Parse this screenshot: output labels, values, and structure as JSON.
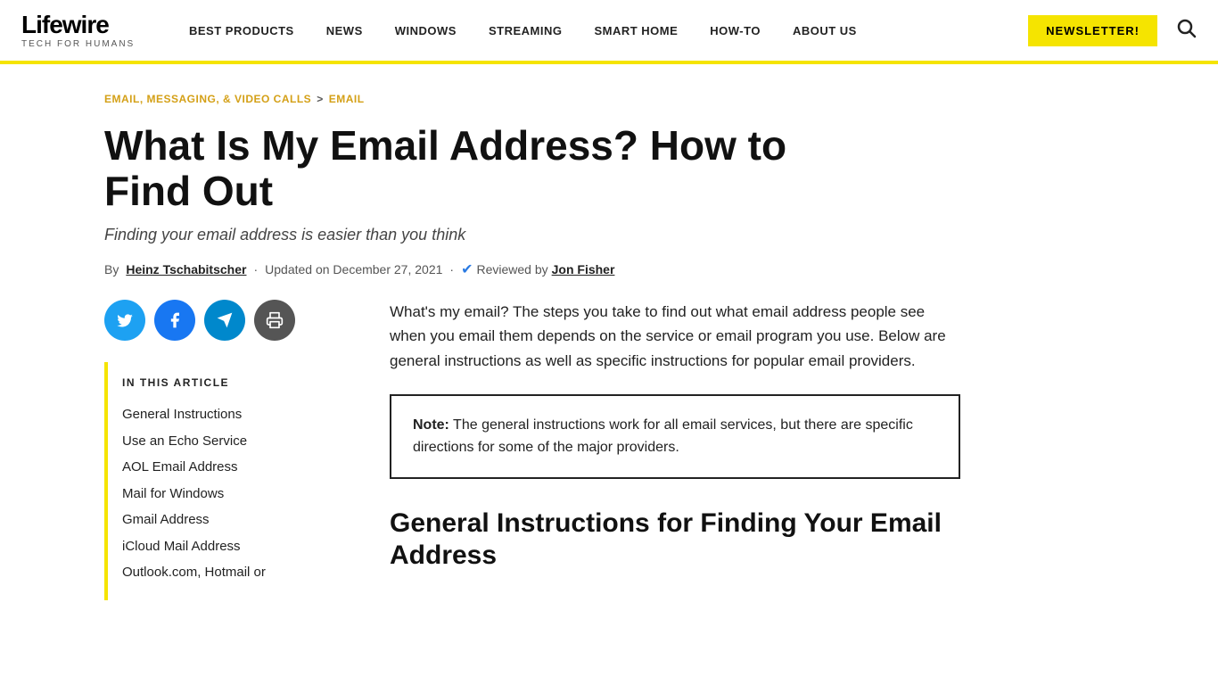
{
  "header": {
    "logo_text": "Lifewire",
    "logo_tagline": "TECH FOR HUMANS",
    "nav_items": [
      {
        "label": "BEST PRODUCTS",
        "id": "best-products"
      },
      {
        "label": "NEWS",
        "id": "news"
      },
      {
        "label": "WINDOWS",
        "id": "windows"
      },
      {
        "label": "STREAMING",
        "id": "streaming"
      },
      {
        "label": "SMART HOME",
        "id": "smart-home"
      },
      {
        "label": "HOW-TO",
        "id": "how-to"
      },
      {
        "label": "ABOUT US",
        "id": "about-us"
      }
    ],
    "newsletter_label": "NEWSLETTER!",
    "search_icon": "🔍"
  },
  "breadcrumb": {
    "parent_link": "EMAIL, MESSAGING, & VIDEO CALLS",
    "separator": ">",
    "current": "EMAIL"
  },
  "article": {
    "title": "What Is My Email Address? How to Find Out",
    "subtitle": "Finding your email address is easier than you think",
    "by_label": "By",
    "author": "Heinz Tschabitscher",
    "updated_label": "Updated on December 27, 2021",
    "reviewed_label": "Reviewed by",
    "reviewer": "Jon Fisher"
  },
  "social": {
    "twitter_title": "Share on Twitter",
    "facebook_title": "Share on Facebook",
    "telegram_title": "Share on Telegram",
    "print_title": "Print"
  },
  "toc": {
    "title": "IN THIS ARTICLE",
    "items": [
      "General Instructions",
      "Use an Echo Service",
      "AOL Email Address",
      "Mail for Windows",
      "Gmail Address",
      "iCloud Mail Address",
      "Outlook.com, Hotmail or"
    ]
  },
  "body": {
    "intro": "What's my email? The steps you take to find out what email address people see when you email them depends on the service or email program you use. Below are general instructions as well as specific instructions for popular email providers.",
    "note_label": "Note:",
    "note_text": "The general instructions work for all email services, but there are specific directions for some of the major providers.",
    "section_heading": "General Instructions for Finding Your Email Address"
  },
  "colors": {
    "accent_yellow": "#f5e400",
    "link_gold": "#d4a017",
    "blue_link": "#2a7ae2"
  }
}
